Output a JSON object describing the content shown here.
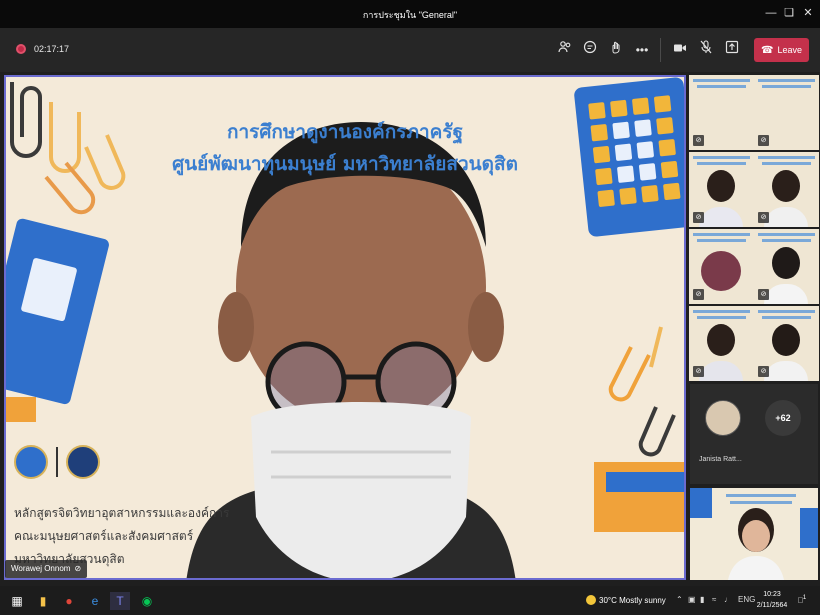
{
  "window": {
    "title": "การประชุมใน \"General\""
  },
  "meeting": {
    "timer": "02:17:17",
    "leave_label": "Leave",
    "leave_color": "#c4314b"
  },
  "main_video": {
    "slide_title_1": "การศึกษาดูงานองค์กรภาครัฐ",
    "slide_title_2": "ศูนย์พัฒนาทุนมนุษย์ มหาวิทยาลัยสวนดุสิต",
    "footer_1": "หลักสูตรจิตวิทยาอุตสาหกรรมและองค์การ",
    "footer_2": "คณะมนุษยศาสตร์และสังคมศาสตร์",
    "footer_3": "มหาวิทยาลัยสวนดุสิต",
    "presenter_name": "Worawej Onnom"
  },
  "gallery": {
    "janista_name": "Janista Ratt...",
    "overflow_count": "+62"
  },
  "taskbar": {
    "weather": "30°C  Mostly sunny",
    "language": "ENG",
    "time": "10:23",
    "date": "2/11/2564",
    "notification_badge": "1"
  }
}
